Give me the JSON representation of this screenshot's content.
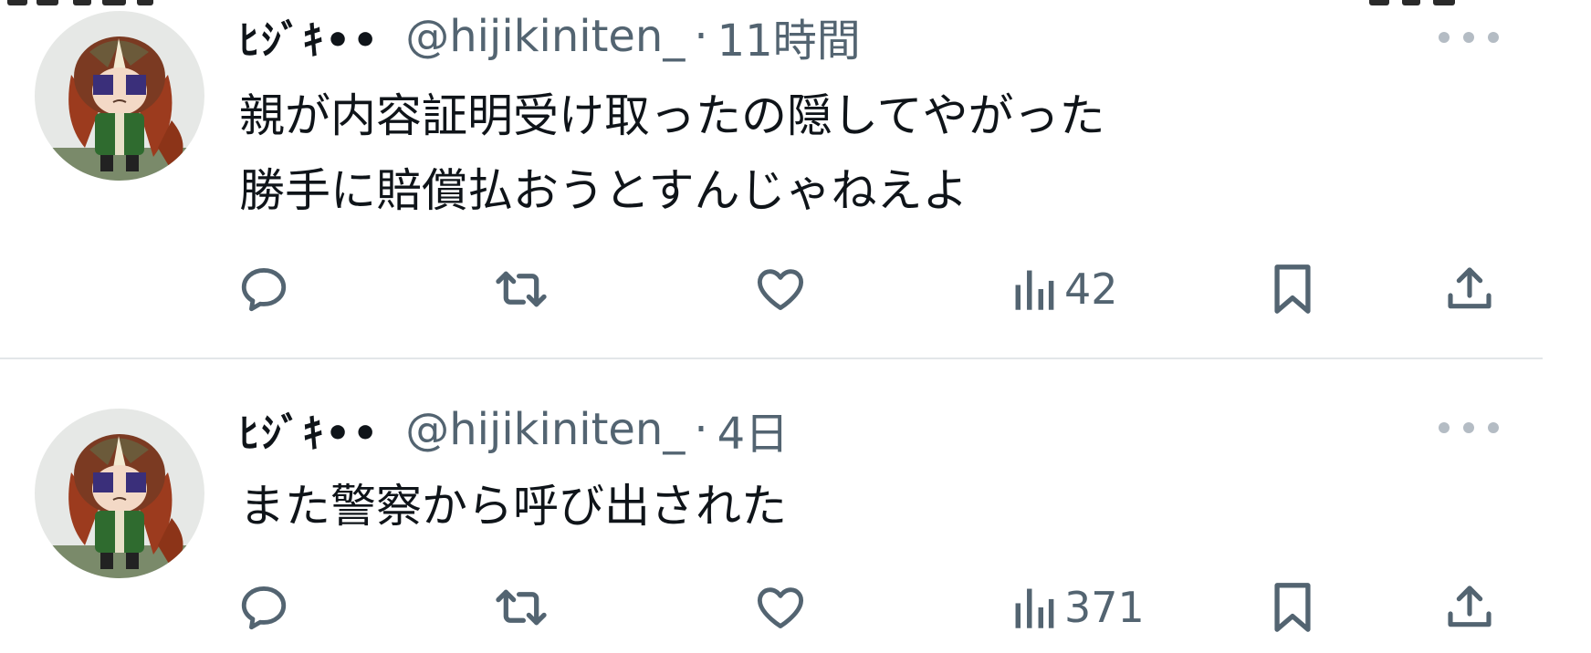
{
  "tweets": [
    {
      "display_name": "ﾋｼﾞｷ••",
      "handle": "@hijikiniten_",
      "separator": "·",
      "time": "11時間",
      "lines": [
        "親が内容証明受け取ったの隠してやがった",
        "勝手に賠償払おうとすんじゃねえよ"
      ],
      "views": "42"
    },
    {
      "display_name": "ﾋｼﾞｷ••",
      "handle": "@hijikiniten_",
      "separator": "·",
      "time": "4日",
      "lines": [
        "また警察から呼び出された"
      ],
      "views": "371"
    }
  ],
  "icons": {
    "more": "more-horizontal-icon",
    "reply": "reply-icon",
    "retweet": "retweet-icon",
    "like": "heart-icon",
    "views": "views-icon",
    "bookmark": "bookmark-icon",
    "share": "share-icon"
  },
  "colors": {
    "text": "#0f1419",
    "secondary": "#536471",
    "divider": "#e3e6e9",
    "more_dots": "#b4bcc4"
  }
}
